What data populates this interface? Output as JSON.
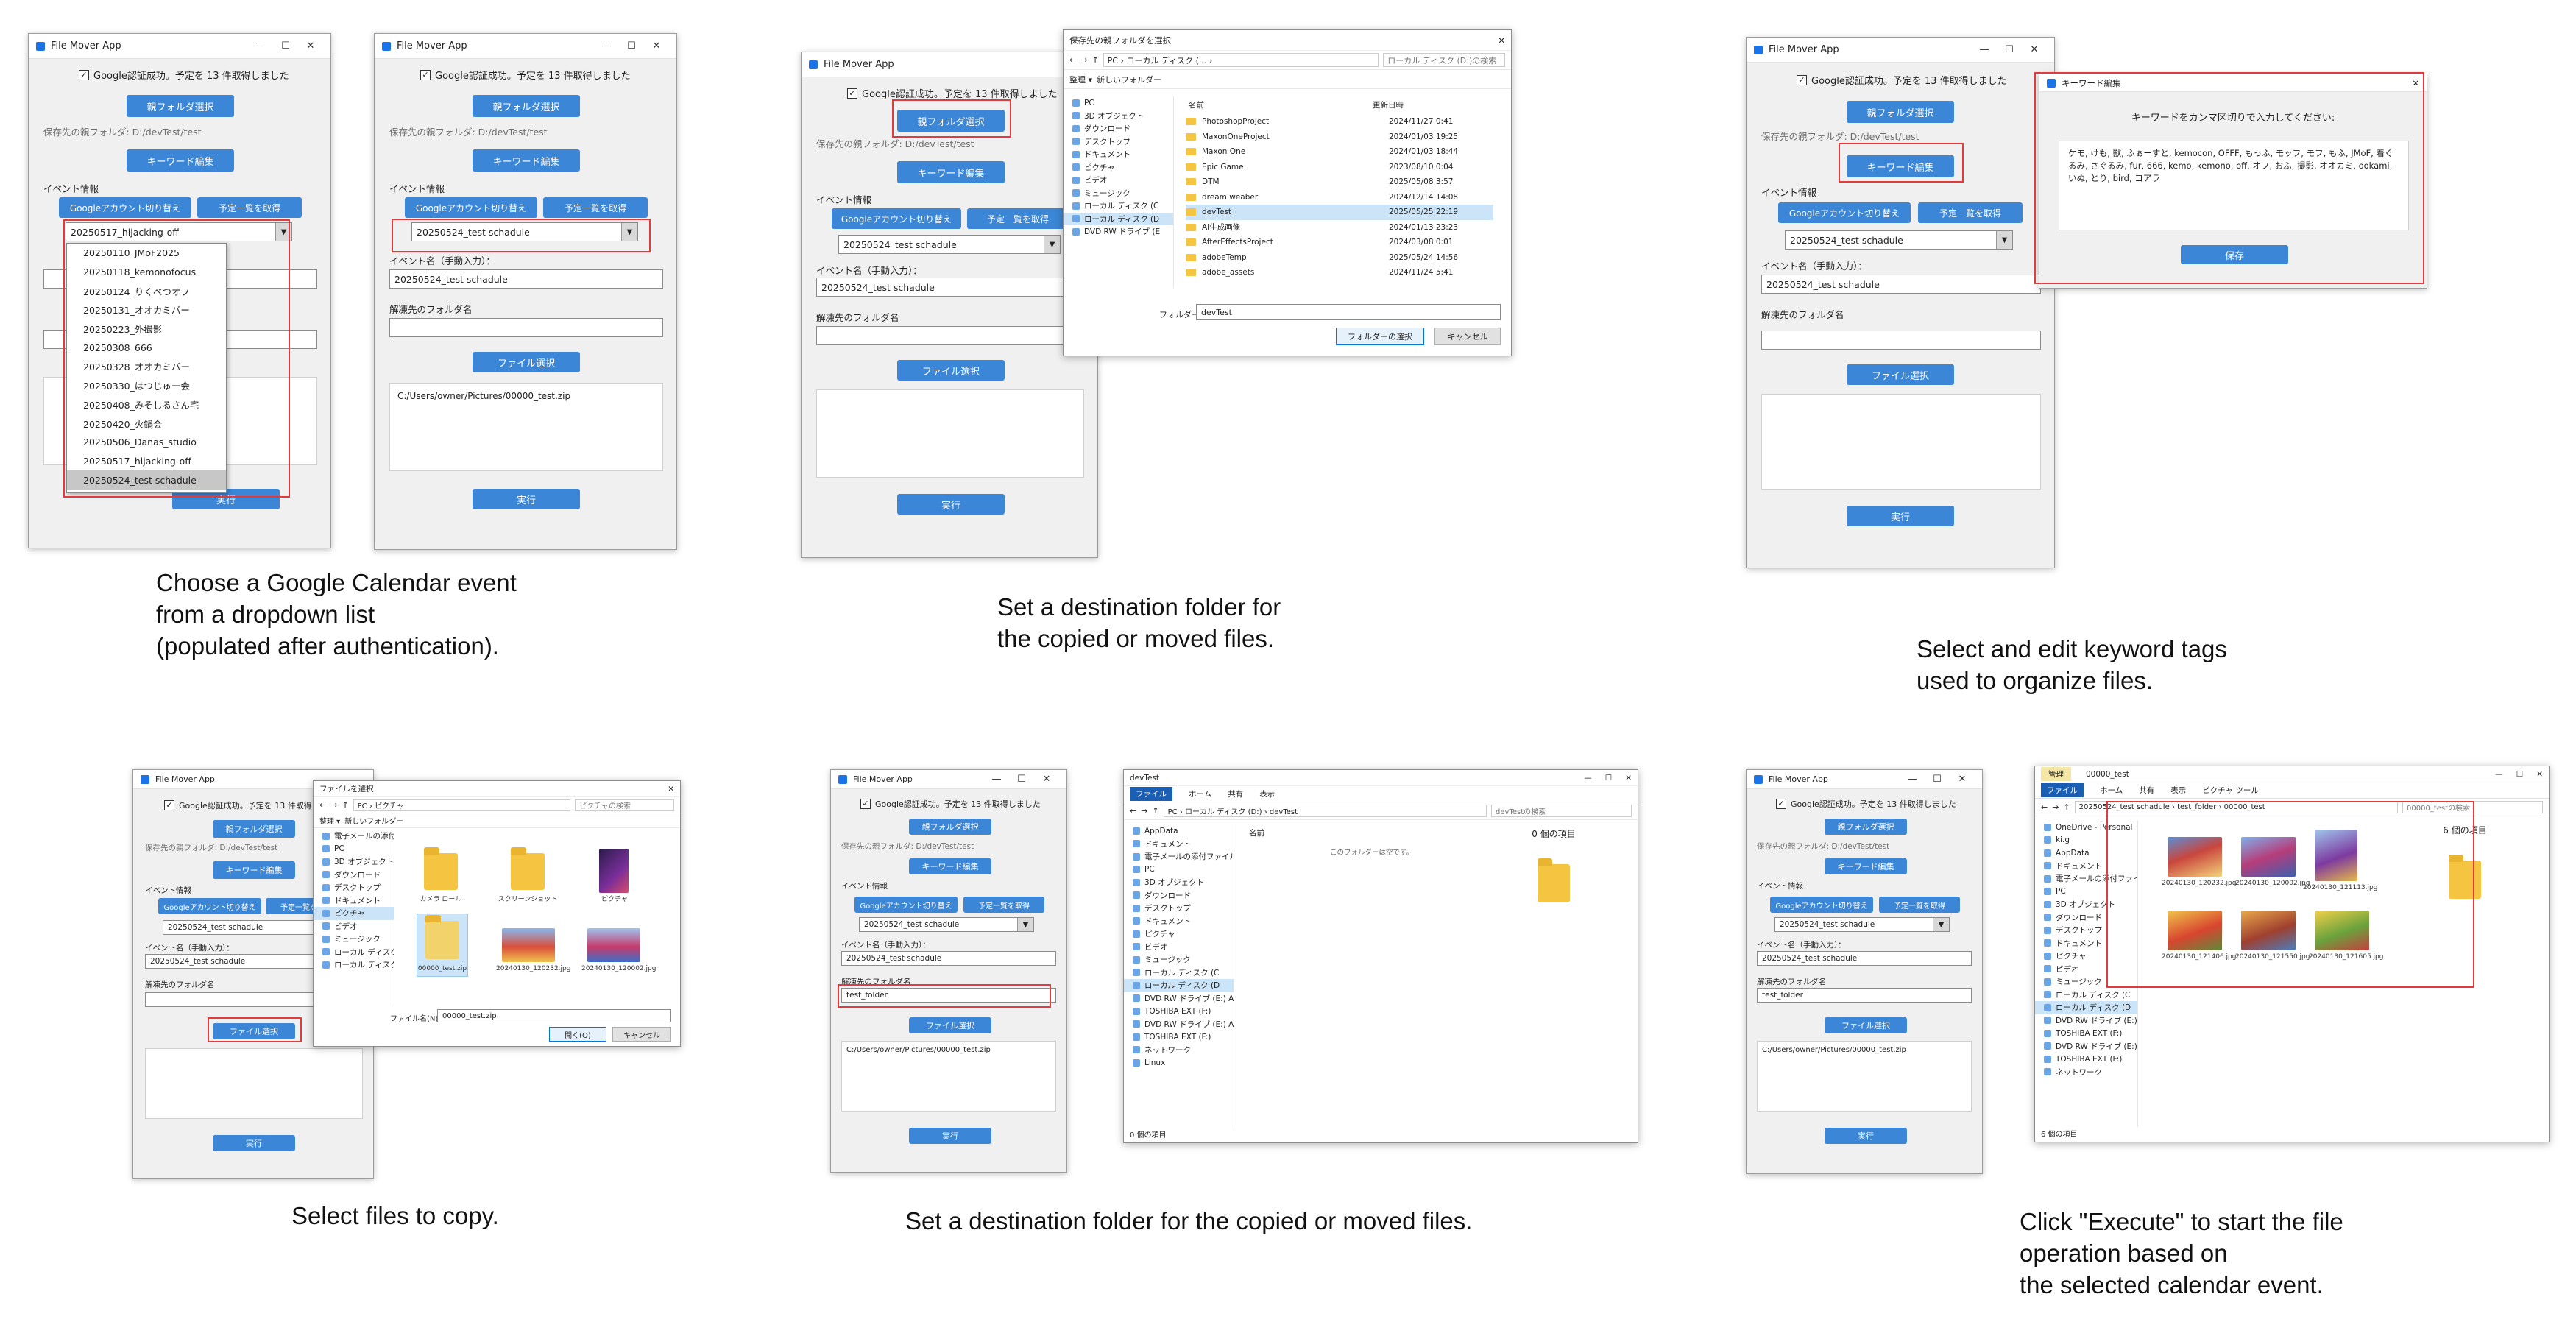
{
  "app": {
    "title": "File Mover App",
    "status": "Google認証成功。予定を 13 件取得しました",
    "parent_btn": "親フォルダ選択",
    "dest_label": "保存先の親フォルダ: D:/devTest/test",
    "keyword_btn": "キーワード編集",
    "event_info": "イベント情報",
    "switch_btn": "Googleアカウント切り替え",
    "fetch_btn": "予定一覧を取得",
    "event_name_label": "イベント名（手動入力）：",
    "unzip_label": "解凍先のフォルダ名",
    "file_btn": "ファイル選択",
    "run_btn": "実行",
    "event_test": "20250524_test schadule",
    "event_hijack": "20250517_hijacking-off",
    "selected_file": "C:/Users/owner/Pictures/00000_test.zip",
    "unzip_value": "test_folder"
  },
  "dropdown_items": [
    "20250110_JMoF2025",
    "20250118_kemonofocus",
    "20250124_りくべつオフ",
    "20250131_オオカミバー",
    "20250223_外撮影",
    "20250308_666",
    "20250328_オオカミバー",
    "20250330_はつじゅー会",
    "20250408_みそしるさん宅",
    "20250420_火鍋会",
    "20250506_Danas_studio",
    "20250517_hijacking-off",
    "20250524_test schadule"
  ],
  "captions": [
    "Choose a Google Calendar event\nfrom a dropdown list\n(populated after authentication).",
    "Set a destination folder for\nthe copied or moved files.",
    "Select and edit keyword tags\nused to organize files.",
    "Select files to copy.",
    "Set a destination folder for the copied or moved files.",
    "Click \"Execute\" to start the file\noperation based on\nthe selected calendar event."
  ],
  "folder_dialog": {
    "title": "保存先の親フォルダを選択",
    "path": "PC › ローカル ディスク (... › ",
    "search": "ローカル ディスク (D:)の検索",
    "organize": "整理 ▾",
    "newfolder": "新しいフォルダー",
    "col_name": "名前",
    "col_date": "更新日時",
    "nav": [
      "PC",
      "3D オブジェクト",
      "ダウンロード",
      "デスクトップ",
      "ドキュメント",
      "ピクチャ",
      "ビデオ",
      "ミュージック",
      "ローカル ディスク (C",
      "ローカル ディスク (D",
      "DVD RW ドライブ (E"
    ],
    "rows": [
      [
        "PhotoshopProject",
        "2024/11/27 0:41"
      ],
      [
        "MaxonOneProject",
        "2024/01/03 19:25"
      ],
      [
        "Maxon One",
        "2024/01/03 18:44"
      ],
      [
        "Epic Game",
        "2023/08/10 0:04"
      ],
      [
        "DTM",
        "2025/05/08 3:57"
      ],
      [
        "dream weaber",
        "2024/12/14 14:08"
      ],
      [
        "devTest",
        "2025/05/25 22:19"
      ],
      [
        "AI生成画像",
        "2024/01/13 23:23"
      ],
      [
        "AfterEffectsProject",
        "2024/03/08 0:01"
      ],
      [
        "adobeTemp",
        "2025/05/24 14:56"
      ],
      [
        "adobe_assets",
        "2024/11/24 5:41"
      ]
    ],
    "folder_label": "フォルダー:",
    "folder_value": "devTest",
    "select_btn": "フォルダーの選択",
    "cancel_btn": "キャンセル"
  },
  "keyword_dialog": {
    "title": "キーワード編集",
    "prompt": "キーワードをカンマ区切りで入力してください:",
    "text": "ケモ, けも, 獣, ふぁーすと, kemocon, OFFF, もっふ, モッフ, モフ, もふ, JMoF, 着ぐるみ, さぐるみ, fur, 666, kemo, kemono, off, オフ, おふ, 撮影, オオカミ, ookami, いぬ, とり, bird, コアラ",
    "save_btn": "保存"
  },
  "file_dialog": {
    "title": "ファイルを選択",
    "path": "PC › ピクチャ",
    "search": "ピクチャの検索",
    "organize": "整理 ▾",
    "newfolder": "新しいフォルダー",
    "nav": [
      "電子メールの添付ファ",
      "PC",
      "3D オブジェクト",
      "ダウンロード",
      "デスクトップ",
      "ドキュメント",
      "ピクチャ",
      "ビデオ",
      "ミュージック",
      "ローカル ディスク (C",
      "ローカル ディスク (D"
    ],
    "items": [
      "カメラ ロール",
      "スクリーンショット",
      "ピクチャ",
      "00000_test.zip",
      "20240130_120232.jpg",
      "20240130_120002.jpg"
    ],
    "filename_label": "ファイル名(N):",
    "filename_value": "00000_test.zip",
    "open_btn": "開く(O)",
    "cancel_btn": "キャンセル"
  },
  "explorer1": {
    "title": "devTest",
    "tabs": [
      "ファイル",
      "ホーム",
      "共有",
      "表示"
    ],
    "path": "PC › ローカル ディスク (D:) › devTest",
    "search": "devTestの検索",
    "col_name": "名前",
    "empty": "このフォルダーは空です。",
    "count": "0 個の項目",
    "status": "0 個の項目",
    "nav": [
      "AppData",
      "ドキュメント",
      "電子メールの添付ファイル",
      "PC",
      "3D オブジェクト",
      "ダウンロード",
      "デスクトップ",
      "ドキュメント",
      "ピクチャ",
      "ビデオ",
      "ミュージック",
      "ローカル ディスク (C",
      "ローカル ディスク (D",
      "DVD RW ドライブ (E:) Audi",
      "TOSHIBA EXT (F:)",
      "DVD RW ドライブ (E:) Audi",
      "TOSHIBA EXT (F:)",
      "ネットワーク",
      "Linux"
    ]
  },
  "explorer2": {
    "title": "00000_test",
    "manage": "管理",
    "tabs": [
      "ファイル",
      "ホーム",
      "共有",
      "表示",
      "ピクチャ ツール"
    ],
    "path": "20250524_test schadule › test_folder › 00000_test",
    "search": "00000_testの検索",
    "count": "6 個の項目",
    "status": "6 個の項目",
    "thumbs": [
      "20240130_120232.jpg",
      "20240130_120002.jpg",
      "20240130_121113.jpg",
      "20240130_121406.jpg",
      "20240130_121550.jpg",
      "20240130_121605.jpg"
    ],
    "nav": [
      "OneDrive - Personal",
      "ki.g",
      "AppData",
      "ドキュメント",
      "電子メールの添付ファイル",
      "PC",
      "3D オブジェクト",
      "ダウンロード",
      "デスクトップ",
      "ドキュメント",
      "ピクチャ",
      "ビデオ",
      "ミュージック",
      "ローカル ディスク (C",
      "ローカル ディスク (D",
      "DVD RW ドライブ (E:) Audi",
      "TOSHIBA EXT (F:)",
      "DVD RW ドライブ (E:) Audi",
      "TOSHIBA EXT (F:)",
      "ネットワーク"
    ]
  }
}
